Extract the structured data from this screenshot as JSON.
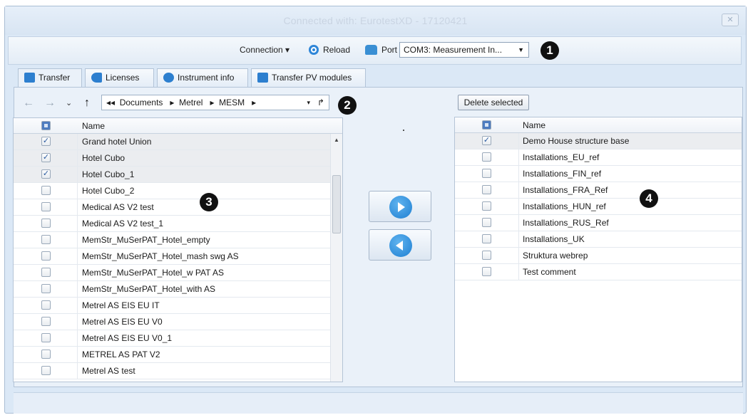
{
  "window": {
    "title": "Connected with: EurotestXD - 17120421",
    "close_icon": "close-icon"
  },
  "toolbar": {
    "connection_label": "Connection ▾",
    "reload_label": "Reload",
    "port_label": "Port",
    "port_value": "COM3: Measurement In...",
    "callout": "1"
  },
  "tabs": [
    {
      "label": "Transfer",
      "icon": "transfer-icon"
    },
    {
      "label": "Licenses",
      "icon": "key-icon"
    },
    {
      "label": "Instrument info",
      "icon": "info-icon"
    },
    {
      "label": "Transfer PV modules",
      "icon": "transfer-icon"
    }
  ],
  "nav": {
    "breadcrumb": [
      "Documents",
      "Metrel",
      "MESM"
    ],
    "callout": "2"
  },
  "left_grid": {
    "header_name": "Name",
    "callout": "3",
    "rows": [
      {
        "name": "Grand hotel Union",
        "checked": true
      },
      {
        "name": "Hotel Cubo",
        "checked": true
      },
      {
        "name": "Hotel Cubo_1",
        "checked": true
      },
      {
        "name": "Hotel Cubo_2",
        "checked": false
      },
      {
        "name": "Medical AS V2 test",
        "checked": false
      },
      {
        "name": "Medical AS V2 test_1",
        "checked": false
      },
      {
        "name": "MemStr_MuSerPAT_Hotel_empty",
        "checked": false
      },
      {
        "name": "MemStr_MuSerPAT_Hotel_mash swg AS",
        "checked": false
      },
      {
        "name": "MemStr_MuSerPAT_Hotel_w PAT AS",
        "checked": false
      },
      {
        "name": "MemStr_MuSerPAT_Hotel_with AS",
        "checked": false
      },
      {
        "name": "Metrel AS EIS EU IT",
        "checked": false
      },
      {
        "name": "Metrel AS EIS EU V0",
        "checked": false
      },
      {
        "name": "Metrel AS EIS EU V0_1",
        "checked": false
      },
      {
        "name": "METREL AS PAT V2",
        "checked": false
      },
      {
        "name": "Metrel AS test",
        "checked": false
      }
    ]
  },
  "right_panel": {
    "delete_label": "Delete selected",
    "header_name": "Name",
    "callout": "4",
    "rows": [
      {
        "name": "Demo House structure base",
        "checked": true
      },
      {
        "name": "Installations_EU_ref",
        "checked": false
      },
      {
        "name": "Installations_FIN_ref",
        "checked": false
      },
      {
        "name": "Installations_FRA_Ref",
        "checked": false
      },
      {
        "name": "Installations_HUN_ref",
        "checked": false
      },
      {
        "name": "Installations_RUS_Ref",
        "checked": false
      },
      {
        "name": "Installations_UK",
        "checked": false
      },
      {
        "name": "Struktura webrep",
        "checked": false
      },
      {
        "name": "Test comment",
        "checked": false
      }
    ]
  },
  "colors": {
    "accent": "#1e7fd2",
    "window_bg": "#dbe8f6",
    "checked_row": "#ebedf0"
  }
}
